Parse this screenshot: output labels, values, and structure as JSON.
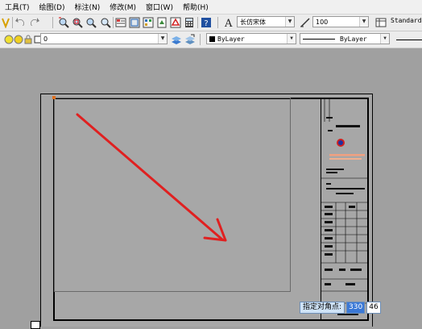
{
  "menu": {
    "items": [
      "工具(T)",
      "绘图(D)",
      "标注(N)",
      "修改(M)",
      "窗口(W)",
      "帮助(H)"
    ]
  },
  "toolbar": {
    "text_style": "长仿宋体",
    "text_height": "100",
    "table_style": "Standard"
  },
  "layers": {
    "current_layer": "0",
    "color": "ByLayer",
    "linetype": "ByLayer"
  },
  "prompt": {
    "label": "指定对角点:",
    "x_value": "330",
    "y_value": "46"
  },
  "colors": {
    "arrow": "#e02020",
    "canvas": "#a0a0a0",
    "sheet": "#a7a7a7"
  },
  "icons": [
    "pan-icon",
    "undo-icon",
    "redo-icon",
    "zoom-realtime-icon",
    "zoom-window-icon",
    "zoom-previous-icon",
    "properties-icon",
    "design-center-icon",
    "tool-palette-icon",
    "sheet-set-icon",
    "markup-icon",
    "calculator-icon",
    "help-icon",
    "text-style-icon",
    "dim-style-icon",
    "table-style-icon",
    "layer-state-icon",
    "layer-manager-icon",
    "make-current-icon"
  ]
}
